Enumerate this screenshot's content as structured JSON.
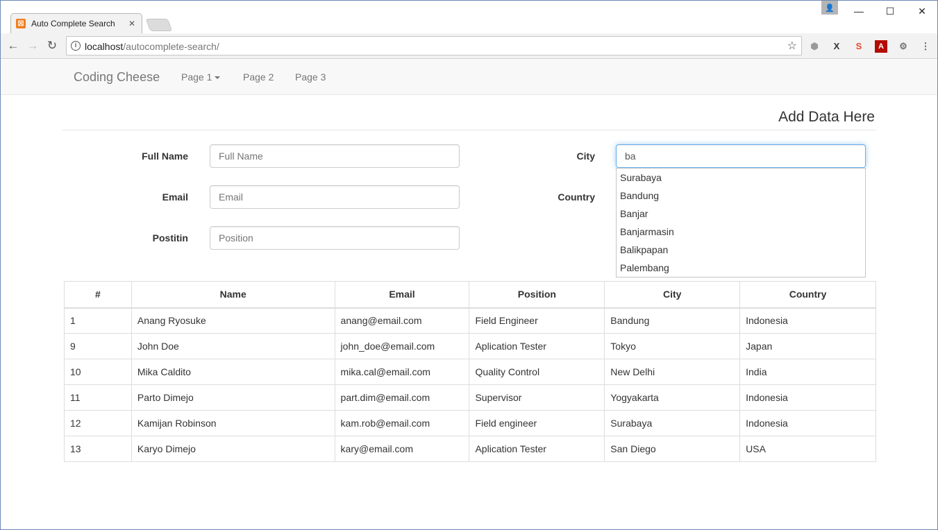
{
  "browser": {
    "tab_title": "Auto Complete Search",
    "url_host": "localhost",
    "url_path": "/autocomplete-search/"
  },
  "navbar": {
    "brand": "Coding Cheese",
    "items": [
      "Page 1",
      "Page 2",
      "Page 3"
    ]
  },
  "form": {
    "legend": "Add Data Here",
    "full_name": {
      "label": "Full Name",
      "placeholder": "Full Name"
    },
    "email": {
      "label": "Email",
      "placeholder": "Email"
    },
    "position": {
      "label": "Postitin",
      "placeholder": "Position"
    },
    "city": {
      "label": "City",
      "value": "ba"
    },
    "country": {
      "label": "Country"
    },
    "suggestions": [
      "Surabaya",
      "Bandung",
      "Banjar",
      "Banjarmasin",
      "Balikpapan",
      "Palembang"
    ]
  },
  "table": {
    "headers": [
      "#",
      "Name",
      "Email",
      "Position",
      "City",
      "Country"
    ],
    "rows": [
      [
        "1",
        "Anang Ryosuke",
        "anang@email.com",
        "Field Engineer",
        "Bandung",
        "Indonesia"
      ],
      [
        "9",
        "John Doe",
        "john_doe@email.com",
        "Aplication Tester",
        "Tokyo",
        "Japan"
      ],
      [
        "10",
        "Mika Caldito",
        "mika.cal@email.com",
        "Quality Control",
        "New Delhi",
        "India"
      ],
      [
        "11",
        "Parto Dimejo",
        "part.dim@email.com",
        "Supervisor",
        "Yogyakarta",
        "Indonesia"
      ],
      [
        "12",
        "Kamijan Robinson",
        "kam.rob@email.com",
        "Field engineer",
        "Surabaya",
        "Indonesia"
      ],
      [
        "13",
        "Karyo Dimejo",
        "kary@email.com",
        "Aplication Tester",
        "San Diego",
        "USA"
      ]
    ]
  }
}
